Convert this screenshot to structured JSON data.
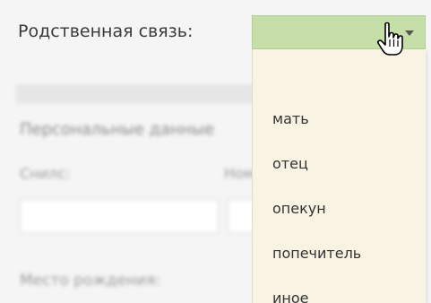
{
  "field": {
    "label": "Родственная связь:",
    "selected_value": ""
  },
  "dropdown": {
    "options": [
      "мать",
      "отец",
      "опекун",
      "попечитель",
      "иное"
    ]
  },
  "background_form": {
    "section_heading": "Персональные данные",
    "label_left": "Снилс:",
    "label_right": "Ном",
    "bottom_label": "Место рождения:"
  },
  "colors": {
    "select_bg": "#c6dfa8",
    "dropdown_bg": "#f8f3e3",
    "page_bg": "#f5f5f5"
  },
  "icons": {
    "arrow": "triangle-down-icon",
    "cursor": "hand-pointer-icon"
  }
}
